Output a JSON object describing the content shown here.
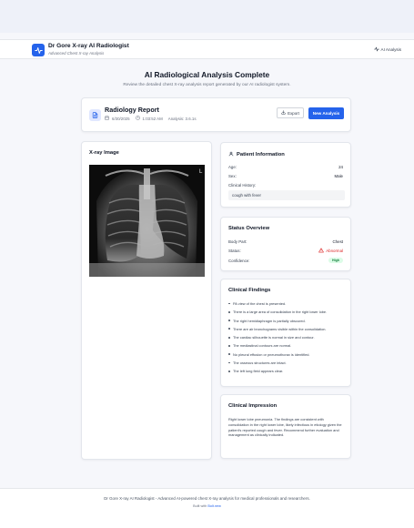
{
  "header": {
    "title": "Dr Gore X-ray AI Radiologist",
    "subtitle": "Advanced Chest X-ray Analysis",
    "nav_link": "AI Analysis"
  },
  "page": {
    "title": "AI Radiological Analysis Complete",
    "subtitle": "Review the detailed chest X-ray analysis report generated by our AI radiologist system."
  },
  "report": {
    "title": "Radiology Report",
    "date": "6/30/2025",
    "time": "1:03:52 AM",
    "analysis": "Analysis: 3.6.1s",
    "export_label": "Export",
    "new_analysis_label": "New Analysis"
  },
  "xray": {
    "label": "X-ray Image",
    "marker": "L"
  },
  "patient": {
    "title": "Patient Information",
    "age_label": "Age:",
    "age_value": "24",
    "sex_label": "Sex:",
    "sex_value": "Male",
    "history_label": "Clinical History:",
    "history_value": "cough with fever"
  },
  "status": {
    "title": "Status Overview",
    "body_part_label": "Body Part:",
    "body_part_value": "Chest",
    "status_label": "Status:",
    "status_value": "Abnormal",
    "confidence_label": "Confidence:",
    "confidence_value": "High"
  },
  "findings": {
    "title": "Clinical Findings",
    "items": [
      "PA view of the chest is presented.",
      "There is a large area of consolidation in the right lower lobe.",
      "The right hemidiaphragm is partially obscured.",
      "There are air bronchograms visible within the consolidation.",
      "The cardiac silhouette is normal in size and contour.",
      "The mediastinal contours are normal.",
      "No pleural effusion or pneumothorax is identified.",
      "The osseous structures are intact.",
      "The left lung field appears clear."
    ]
  },
  "impression": {
    "title": "Clinical Impression",
    "text": "Right lower lobe pneumonia. The findings are consistent with consolidation in the right lower lobe, likely infectious in etiology given the patient's reported cough and fever. Recommend further evaluation and management as clinically indicated."
  },
  "footer": {
    "text": "Dr Gore X-ray AI Radiologist - Advanced AI-powered chest X-ray analysis for medical professionals and researchers.",
    "built_prefix": "Built with",
    "built_link": "Bolt.new"
  },
  "colors": {
    "accent": "#2563eb",
    "abnormal": "#dc2626",
    "high_badge_bg": "#dcfce7",
    "high_badge_text": "#15803d"
  },
  "icons": {
    "logo": "activity-icon",
    "nav": "activity-icon",
    "report": "document-icon",
    "date": "calendar-icon",
    "time": "clock-icon",
    "export": "download-icon",
    "patient": "user-icon",
    "abnormal": "alert-triangle-icon"
  }
}
